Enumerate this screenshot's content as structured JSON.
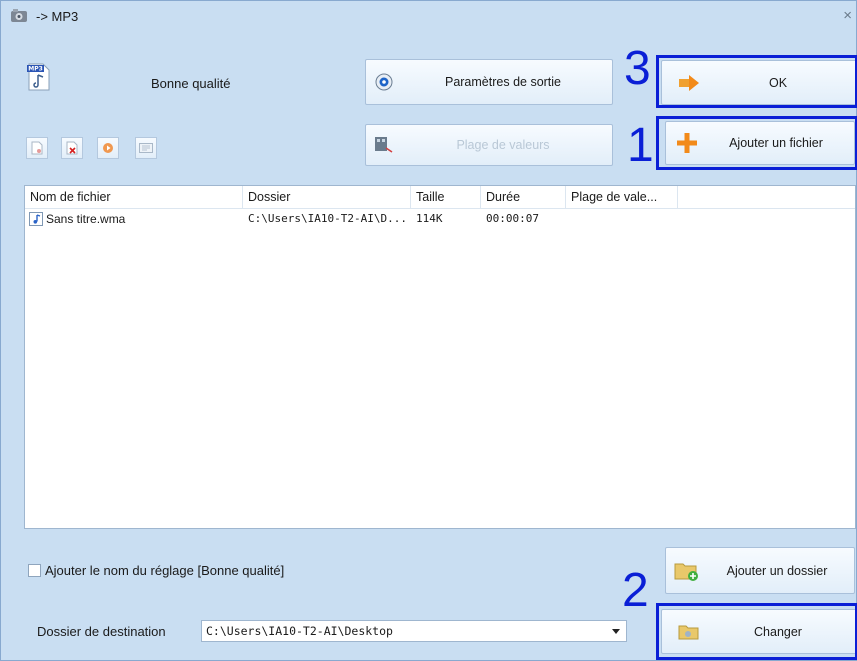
{
  "window": {
    "title": "-> MP3",
    "close": "×"
  },
  "preset": {
    "format_badge": "MP3",
    "quality_label": "Bonne qualité"
  },
  "buttons": {
    "output_settings": "Paramètres de sortie",
    "ok": "OK",
    "value_range": "Plage de valeurs",
    "add_file": "Ajouter un fichier",
    "add_folder": "Ajouter un dossier",
    "change": "Changer"
  },
  "annotations": {
    "one": "1",
    "two": "2",
    "three": "3"
  },
  "table": {
    "columns": [
      "Nom de fichier",
      "Dossier",
      "Taille",
      "Durée",
      "Plage de vale..."
    ],
    "rows": [
      {
        "name": "Sans titre.wma",
        "folder": "C:\\Users\\IA10-T2-AI\\D...",
        "size": "114K",
        "duration": "00:00:07",
        "range": ""
      }
    ]
  },
  "options": {
    "append_preset_label": "Ajouter le nom du réglage [Bonne qualité]",
    "append_preset_checked": false
  },
  "destination": {
    "label": "Dossier de destination",
    "value": "C:\\Users\\IA10-T2-AI\\Desktop"
  },
  "colors": {
    "window_bg": "#c9def2",
    "annotation": "#0a1fd6",
    "accent_orange": "#f28a1a"
  },
  "icons": [
    "app-icon",
    "mp3-file-icon",
    "output-settings-icon",
    "ok-arrow-icon",
    "value-range-icon",
    "add-file-plus-icon",
    "add-folder-icon",
    "change-folder-icon",
    "music-note-icon"
  ]
}
